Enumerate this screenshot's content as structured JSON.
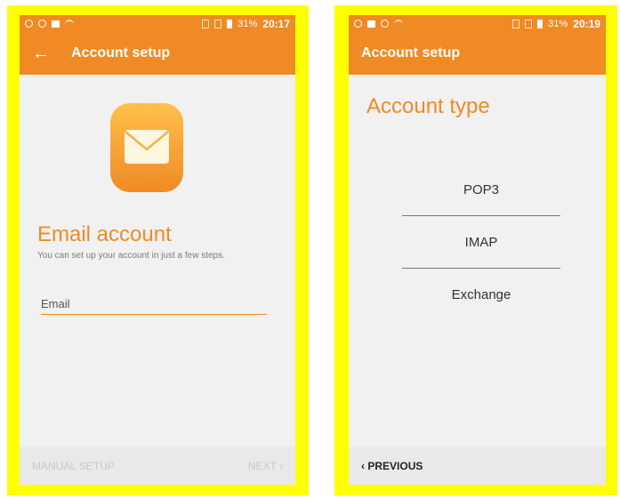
{
  "status_bars": [
    {
      "battery": "31%",
      "time": "20:17"
    },
    {
      "battery": "31%",
      "time": "20:19"
    }
  ],
  "left_screen": {
    "appbar_title": "Account setup",
    "back_icon": "back-arrow-icon",
    "app_icon": "email-envelope-icon",
    "heading": "Email account",
    "subtitle": "You can set up your account in just a few steps.",
    "email_placeholder": "Email",
    "manual_setup_label": "MANUAL SETUP",
    "next_label": "NEXT",
    "next_chevron": "›"
  },
  "right_screen": {
    "appbar_title": "Account setup",
    "heading": "Account type",
    "options": [
      "POP3",
      "IMAP",
      "Exchange"
    ],
    "previous_label": "PREVIOUS",
    "previous_chevron": "‹"
  },
  "colors": {
    "accent": "#f08a24",
    "frame": "#ffff00",
    "screen_bg": "#f1f1f1"
  }
}
